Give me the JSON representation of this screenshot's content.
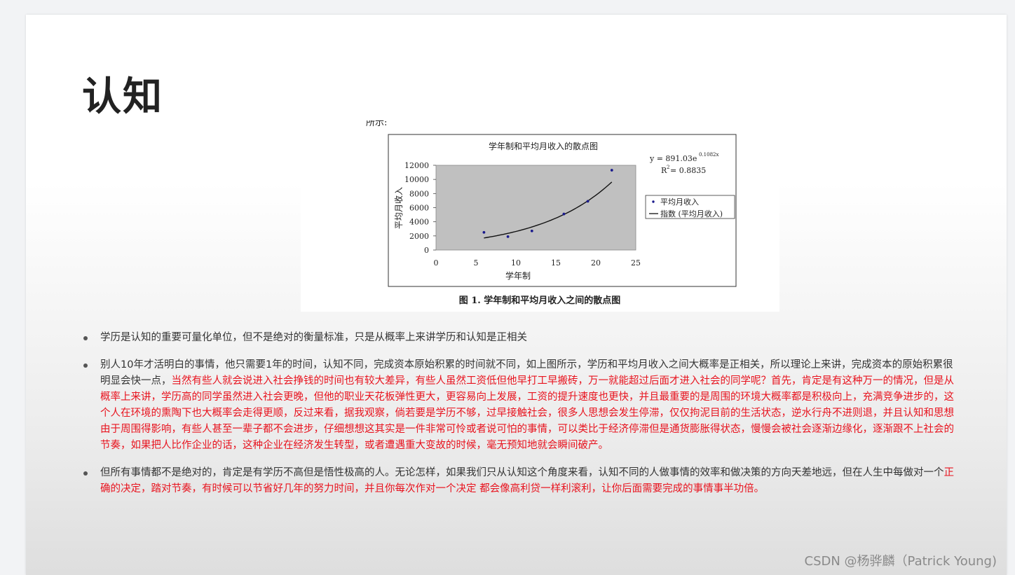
{
  "page": {
    "title": "认知",
    "watermark": "CSDN @杨骅麟（Patrick Young)"
  },
  "figure": {
    "caption_top": "所示:",
    "caption": "图 1. 学年制和平均月收入之间的散点图",
    "equation": "y = 891.03e",
    "exponent": "0.1082x",
    "r2_label": "R",
    "r2_value": " = 0.8835",
    "legend_points": "平均月收入",
    "legend_line": "指数 (平均月收入)"
  },
  "chart_data": {
    "type": "scatter",
    "title": "学年制和平均月收入的散点图",
    "xlabel": "学年制",
    "ylabel": "平均月收入",
    "xlim": [
      0,
      25
    ],
    "ylim": [
      0,
      12000
    ],
    "xticks": [
      "0",
      "5",
      "10",
      "15",
      "20",
      "25"
    ],
    "yticks": [
      "0",
      "2000",
      "4000",
      "6000",
      "8000",
      "10000",
      "12000"
    ],
    "series": [
      {
        "name": "平均月收入",
        "x": [
          6,
          9,
          12,
          16,
          19,
          22
        ],
        "y": [
          2500,
          1900,
          2700,
          5100,
          6900,
          11300
        ]
      }
    ],
    "trendline": {
      "name": "指数 (平均月收入)",
      "a": 891.03,
      "b": 0.1082,
      "x_range": [
        6,
        22
      ]
    },
    "plot_background": "#c0c0c0",
    "point_color": "#1a1a8c",
    "legend_position": "right"
  },
  "bullets": [
    {
      "segments": [
        {
          "text": "学历是认知的重要可量化单位，但不是绝对的衡量标准，只是从概率上来讲学历和认知是正相关",
          "red": false
        }
      ]
    },
    {
      "segments": [
        {
          "text": "别人10年才活明白的事情，他只需要1年的时间，认知不同，完成资本原始积累的时间就不同，如上图所示，学历和平均月收入之间大概率是正相关，所以理论上来讲，完成资本的原始积累很明显会快一点，",
          "red": false
        },
        {
          "text": "当然有些人就会说进入社会挣钱的时间也有较大差异，有些人虽然工资低但他早打工早搬砖，万一就能超过后面才进入社会的同学呢？首先，肯定是有这种万一的情况，但是从概率上来讲，学历高的同学虽然进入社会更晚，但他的职业天花板弹性更大，更容易向上发展，工资的提升速度也更快，并且最重要的是周围的环境大概率都是积极向上，充满竞争进步的，这个人在环境的熏陶下也大概率会走得更顺，反过来看，据我观察，倘若要是学历不够，过早接触社会，很多人思想会发生停滞，仅仅拘泥目前的生活状态，逆水行舟不进则退，并且认知和思想由于周围得影响，有些人甚至一辈子都不会进步，仔细想想这其实是一件非常可怜或者说可怕的事情，可以类比于经济停滞但是通货膨胀得状态，慢慢会被社会逐渐边缘化，逐渐跟不上社会的节奏，如果把人比作企业的话，这种企业在经济发生转型，或者遭遇重大变故的时候，毫无预知地就会瞬间破产。",
          "red": true
        }
      ]
    },
    {
      "segments": [
        {
          "text": "但所有事情都不是绝对的，肯定是有学历不高但是悟性极高的人。无论怎样，如果我们只从认知这个角度来看，认知不同的人做事情的效率和做决策的方向天差地远，但在人生中每做对一个",
          "red": false
        },
        {
          "text": "正确的决定，踏对节奏，有时候可以节省好几年的努力时间，并且你每次作对一个决定 都会像高利贷一样利滚利，让你后面需要完成的事情事半功倍。",
          "red": true
        }
      ]
    }
  ]
}
